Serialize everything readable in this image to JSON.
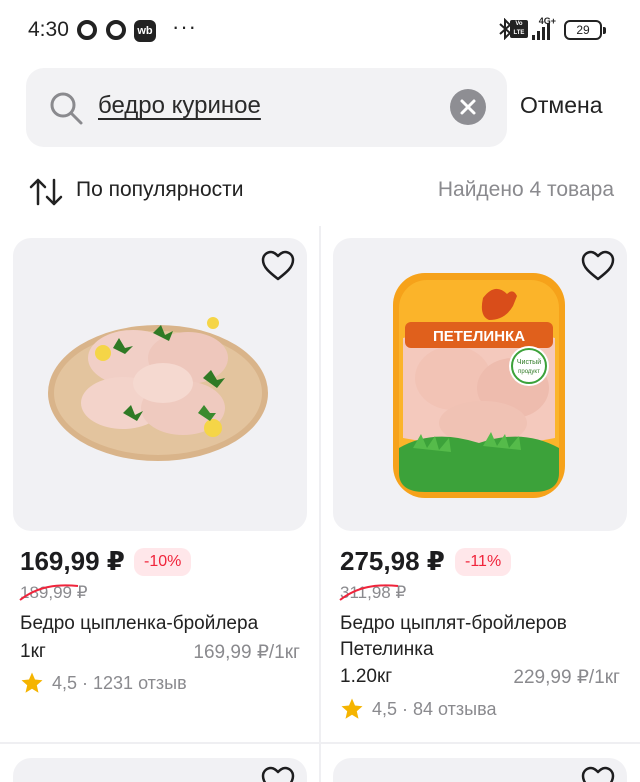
{
  "status_bar": {
    "time": "4:30",
    "app_badge": "wb",
    "more": "···",
    "network": "4G+",
    "volte": "Vo LTE",
    "battery": "29"
  },
  "search": {
    "query": "бедро куриное",
    "cancel_label": "Отмена"
  },
  "sort": {
    "label": "По популярности",
    "found_text": "Найдено 4 товара"
  },
  "products": [
    {
      "price": "169,99 ₽",
      "discount": "-10%",
      "old_price": "189,99 ₽",
      "name": "Бедро цыпленка-бройлера",
      "weight": "1кг",
      "unit_price": "169,99 ₽/1кг",
      "rating": "4,5 · 1231 отзыв"
    },
    {
      "price": "275,98 ₽",
      "discount": "-11%",
      "old_price": "311,98 ₽",
      "name": "Бедро цыплят-бройлеров Петелинка",
      "weight": "1.20кг",
      "unit_price": "229,99 ₽/1кг",
      "rating": "4,5 · 84 отзыва",
      "pack_brand": "ПЕТЕЛИНКА",
      "pack_badge_line1": "Чистый",
      "pack_badge_line2": "продукт"
    }
  ],
  "colors": {
    "accent_red": "#f0243b",
    "discount_bg": "#ffe7ea",
    "muted_text": "#8a8a8e",
    "card_bg": "#f1f1f4",
    "star": "#f5b400"
  },
  "icons": [
    "search-icon",
    "close-icon",
    "sort-icon",
    "heart-icon",
    "star-icon",
    "bluetooth-icon",
    "signal-icon",
    "battery-icon"
  ]
}
